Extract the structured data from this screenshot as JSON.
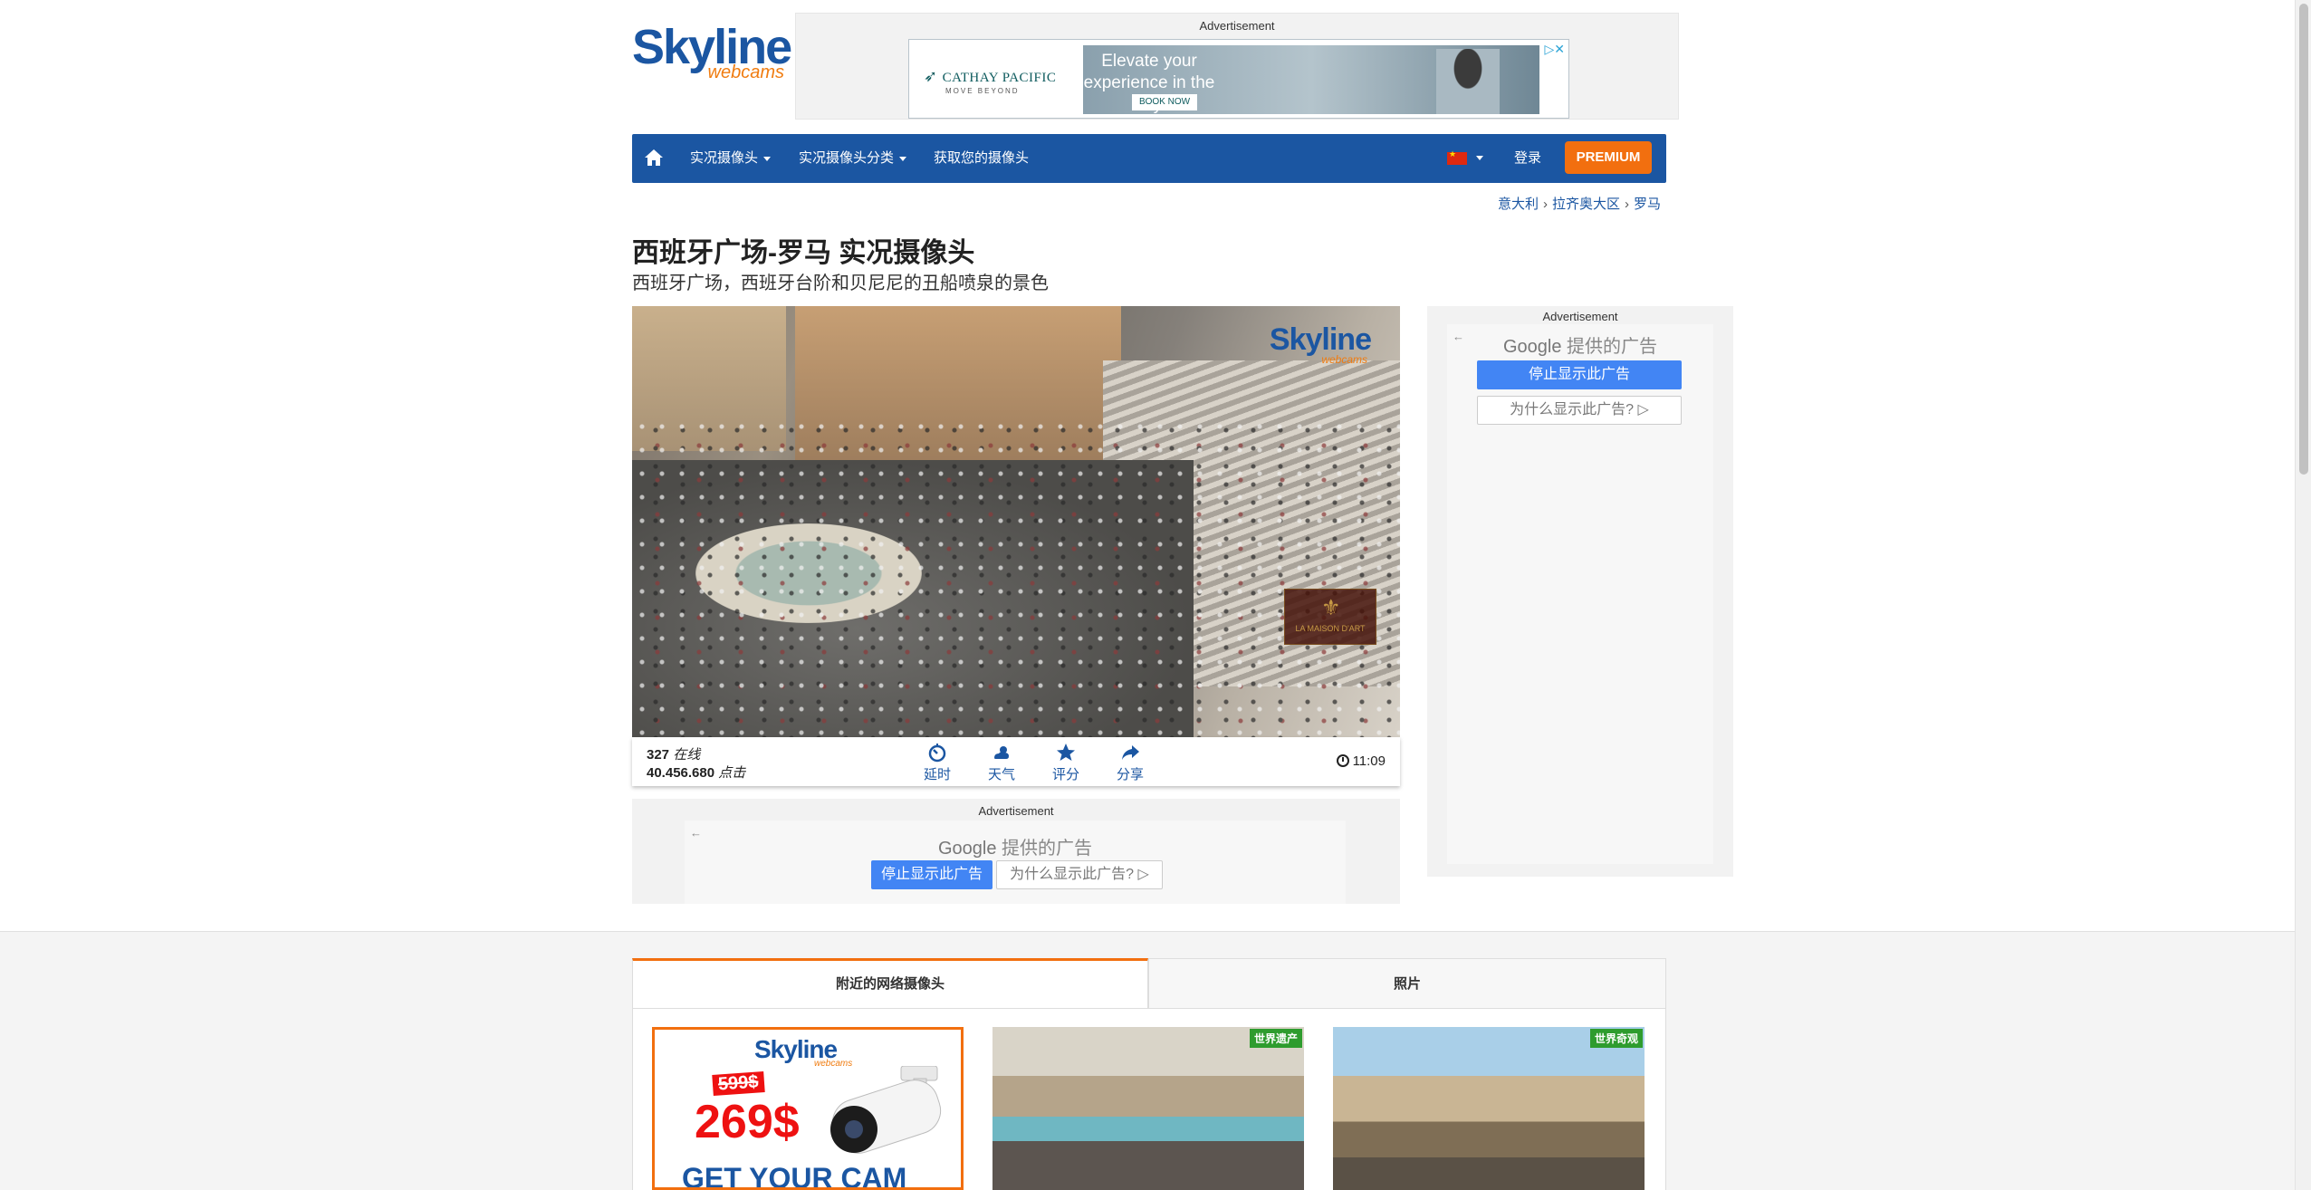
{
  "header": {
    "logo_main": "Skyline",
    "logo_sub": "webcams",
    "ad_label": "Advertisement",
    "banner": {
      "brand": "CATHAY PACIFIC",
      "brand_tagline": "MOVE BEYOND",
      "headline": "Elevate your experience in the sky",
      "cta": "BOOK NOW"
    }
  },
  "nav": {
    "items": [
      {
        "label": "实况摄像头",
        "dropdown": true
      },
      {
        "label": "实况摄像头分类",
        "dropdown": true
      },
      {
        "label": "获取您的摄像头",
        "dropdown": false
      }
    ],
    "login": "登录",
    "premium": "PREMIUM",
    "language_flag": "cn-flag-icon"
  },
  "breadcrumb": [
    "意大利",
    "拉齐奥大区",
    "罗马"
  ],
  "page": {
    "title": "西班牙广场-罗马 实况摄像头",
    "subtitle": "西班牙广场，西班牙台阶和贝尼尼的丑船喷泉的景色"
  },
  "video": {
    "overlay_logo": "Skyline",
    "overlay_logo_sub": "webcams",
    "sponsor": "LA MAISON D'ART"
  },
  "stats": {
    "online_count": "327",
    "online_label": "在线",
    "views_count": "40.456.680",
    "views_label": "点击",
    "actions": [
      {
        "label": "延时",
        "icon": "timelapse-icon"
      },
      {
        "label": "天气",
        "icon": "weather-icon"
      },
      {
        "label": "评分",
        "icon": "star-icon"
      },
      {
        "label": "分享",
        "icon": "share-icon"
      }
    ],
    "time": "11:09"
  },
  "google_ad": {
    "label": "Advertisement",
    "google": "Google",
    "provided": "提供的广告",
    "stop": "停止显示此广告",
    "why": "为什么显示此广告?"
  },
  "tabs": [
    {
      "label": "附近的网络摄像头",
      "active": true
    },
    {
      "label": "照片",
      "active": false
    }
  ],
  "cards": {
    "promo": {
      "logo": "Skyline",
      "logo_sub": "webcams",
      "old_price": "599$",
      "new_price": "269$",
      "cta": "GET YOUR CAM"
    },
    "cam1_badge": "世界遗产",
    "cam2_badge": "世界奇观"
  },
  "colors": {
    "brand_blue": "#1b56a2",
    "accent_orange": "#f26f0f",
    "badge_green": "#2e9c2e"
  }
}
